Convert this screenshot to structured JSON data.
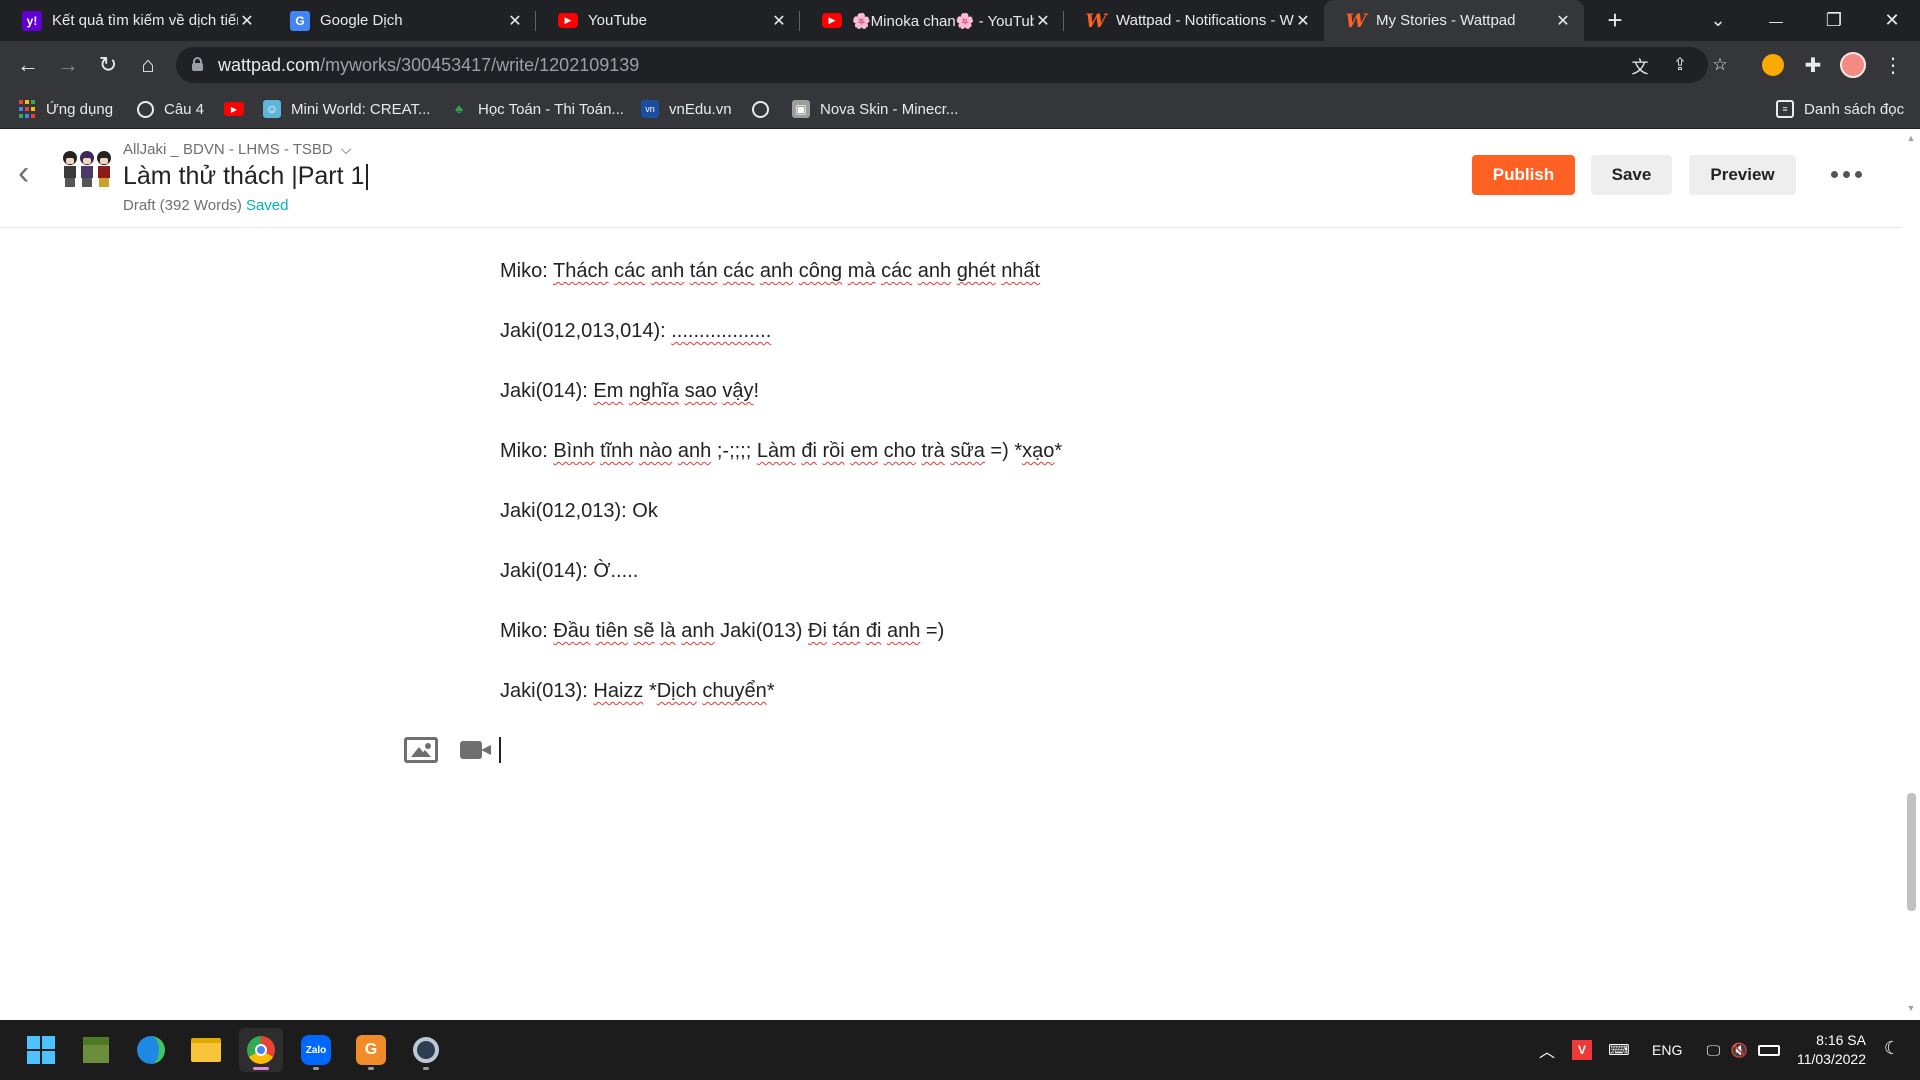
{
  "browser": {
    "tabs": [
      {
        "title": "Kết quả tìm kiếm về dịch tiếng",
        "icon": "yahoo-icon"
      },
      {
        "title": "Google Dịch",
        "icon": "google-translate-icon"
      },
      {
        "title": "YouTube",
        "icon": "youtube-icon"
      },
      {
        "title": "🌸Minoka chan🌸 - YouTube",
        "icon": "youtube-icon"
      },
      {
        "title": "Wattpad - Notifications - Wattpad",
        "icon": "wattpad-icon"
      },
      {
        "title": "My Stories - Wattpad",
        "icon": "wattpad-icon",
        "active": true
      }
    ],
    "new_tab": "+",
    "window_controls": {
      "tab_search": "⌄",
      "minimize": "—",
      "restore": "❐",
      "close": "✕"
    },
    "url_host": "wattpad.com",
    "url_path": "/myworks/300453417/write/1202109139",
    "bookmarks": [
      {
        "label": "Ứng dụng",
        "icon": "apps-grid-icon"
      },
      {
        "label": "Câu 4",
        "icon": "globe-icon"
      },
      {
        "label": "",
        "icon": "youtube-icon"
      },
      {
        "label": "Mini World: CREAT...",
        "icon": "miniworld-icon"
      },
      {
        "label": "Học Toán - Thi Toán...",
        "icon": "hoctoan-icon"
      },
      {
        "label": "vnEdu.vn",
        "icon": "vnedu-icon"
      },
      {
        "label": "",
        "icon": "globe-icon"
      },
      {
        "label": "Nova Skin - Minecr...",
        "icon": "novaskin-icon"
      }
    ],
    "reading_list": "Danh sách đọc"
  },
  "wattpad": {
    "story_name": "AllJaki _ BDVN - LHMS - TSBD",
    "part_title": "Làm thử thách |Part 1",
    "draft_status": "Draft (392 Words)",
    "saved_label": "Saved",
    "publish_label": "Publish",
    "save_label": "Save",
    "preview_label": "Preview",
    "colors": {
      "accent": "#ff6122",
      "saved": "#00b2b2"
    }
  },
  "editor": {
    "paragraphs": [
      [
        {
          "t": "Miko: "
        },
        {
          "t": "Thách",
          "u": 1
        },
        {
          "t": " "
        },
        {
          "t": "các",
          "u": 1
        },
        {
          "t": " "
        },
        {
          "t": "anh",
          "u": 1
        },
        {
          "t": " "
        },
        {
          "t": "tán",
          "u": 1
        },
        {
          "t": " "
        },
        {
          "t": "các",
          "u": 1
        },
        {
          "t": " "
        },
        {
          "t": "anh",
          "u": 1
        },
        {
          "t": " "
        },
        {
          "t": "công",
          "u": 1
        },
        {
          "t": " "
        },
        {
          "t": "mà",
          "u": 1
        },
        {
          "t": " "
        },
        {
          "t": "các",
          "u": 1
        },
        {
          "t": " "
        },
        {
          "t": "anh",
          "u": 1
        },
        {
          "t": " "
        },
        {
          "t": "ghét",
          "u": 1
        },
        {
          "t": " "
        },
        {
          "t": "nhất",
          "u": 1
        }
      ],
      [
        {
          "t": "Jaki(012,013,014): "
        },
        {
          "t": "..................",
          "u": 1
        }
      ],
      [
        {
          "t": "Jaki(014): "
        },
        {
          "t": "Em",
          "u": 1
        },
        {
          "t": " "
        },
        {
          "t": "nghĩa",
          "u": 1
        },
        {
          "t": " "
        },
        {
          "t": "sao",
          "u": 1
        },
        {
          "t": " "
        },
        {
          "t": "vậy",
          "u": 1
        },
        {
          "t": "!"
        }
      ],
      [
        {
          "t": "Miko: "
        },
        {
          "t": "Bình",
          "u": 1
        },
        {
          "t": " "
        },
        {
          "t": "tĩnh",
          "u": 1
        },
        {
          "t": " "
        },
        {
          "t": "nào",
          "u": 1
        },
        {
          "t": " "
        },
        {
          "t": "anh",
          "u": 1
        },
        {
          "t": " ;-;;;; "
        },
        {
          "t": "Làm",
          "u": 1
        },
        {
          "t": " "
        },
        {
          "t": "đi",
          "u": 1
        },
        {
          "t": " "
        },
        {
          "t": "rồi",
          "u": 1
        },
        {
          "t": " "
        },
        {
          "t": "em",
          "u": 1
        },
        {
          "t": " "
        },
        {
          "t": "cho",
          "u": 1
        },
        {
          "t": " "
        },
        {
          "t": "trà",
          "u": 1
        },
        {
          "t": " "
        },
        {
          "t": "sữa",
          "u": 1
        },
        {
          "t": " =) *"
        },
        {
          "t": "xạo",
          "u": 1
        },
        {
          "t": "*"
        }
      ],
      [
        {
          "t": "Jaki(012,013): Ok"
        }
      ],
      [
        {
          "t": "Jaki(014): Ờ....."
        }
      ],
      [
        {
          "t": "Miko: "
        },
        {
          "t": "Đầu",
          "u": 1
        },
        {
          "t": " "
        },
        {
          "t": "tiên",
          "u": 1
        },
        {
          "t": " "
        },
        {
          "t": "sẽ",
          "u": 1
        },
        {
          "t": " "
        },
        {
          "t": "là",
          "u": 1
        },
        {
          "t": " "
        },
        {
          "t": "anh",
          "u": 1
        },
        {
          "t": " Jaki(013) "
        },
        {
          "t": "Đi",
          "u": 1
        },
        {
          "t": " "
        },
        {
          "t": "tán",
          "u": 1
        },
        {
          "t": " "
        },
        {
          "t": "đi",
          "u": 1
        },
        {
          "t": " "
        },
        {
          "t": "anh",
          "u": 1
        },
        {
          "t": " =)"
        }
      ],
      [
        {
          "t": "Jaki(013): "
        },
        {
          "t": "Haizz",
          "u": 1
        },
        {
          "t": " *"
        },
        {
          "t": "Dịch",
          "u": 1
        },
        {
          "t": " "
        },
        {
          "t": "chuyển",
          "u": 1
        },
        {
          "t": "*"
        }
      ]
    ]
  },
  "taskbar": {
    "apps": [
      "windows-start-icon",
      "minecraft-icon",
      "edge-icon",
      "file-explorer-icon",
      "chrome-icon",
      "zalo-icon",
      "garena-icon",
      "settings-app-icon"
    ],
    "zalo_label": "Zalo",
    "language": "ENG",
    "time": "8:16 SA",
    "date": "11/03/2022"
  }
}
